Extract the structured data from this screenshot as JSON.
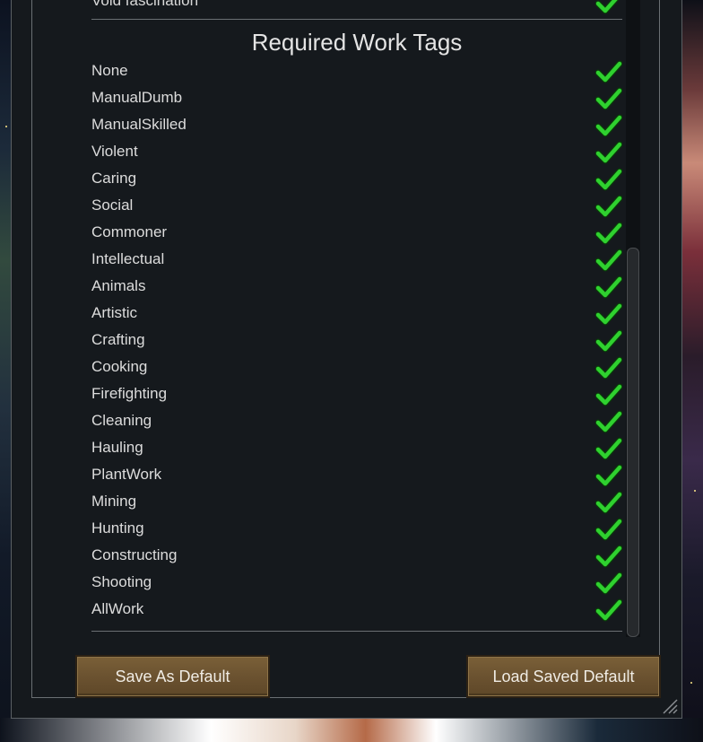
{
  "dialog": {
    "previous_item_label": "Void fascination",
    "section_title": "Required Work Tags",
    "tags": [
      {
        "label": "None",
        "checked": true
      },
      {
        "label": "ManualDumb",
        "checked": true
      },
      {
        "label": "ManualSkilled",
        "checked": true
      },
      {
        "label": "Violent",
        "checked": true
      },
      {
        "label": "Caring",
        "checked": true
      },
      {
        "label": "Social",
        "checked": true
      },
      {
        "label": "Commoner",
        "checked": true
      },
      {
        "label": "Intellectual",
        "checked": true
      },
      {
        "label": "Animals",
        "checked": true
      },
      {
        "label": "Artistic",
        "checked": true
      },
      {
        "label": "Crafting",
        "checked": true
      },
      {
        "label": "Cooking",
        "checked": true
      },
      {
        "label": "Firefighting",
        "checked": true
      },
      {
        "label": "Cleaning",
        "checked": true
      },
      {
        "label": "Hauling",
        "checked": true
      },
      {
        "label": "PlantWork",
        "checked": true
      },
      {
        "label": "Mining",
        "checked": true
      },
      {
        "label": "Hunting",
        "checked": true
      },
      {
        "label": "Constructing",
        "checked": true
      },
      {
        "label": "Shooting",
        "checked": true
      },
      {
        "label": "AllWork",
        "checked": true
      }
    ],
    "buttons": {
      "save_label": "Save As Default",
      "load_label": "Load Saved Default"
    }
  },
  "colors": {
    "check": "#2fd12f",
    "window_bg": "#15191d",
    "button_bg": "#6b5230"
  },
  "icons": {
    "check": "checkmark-icon",
    "resize": "resize-grip-icon"
  }
}
